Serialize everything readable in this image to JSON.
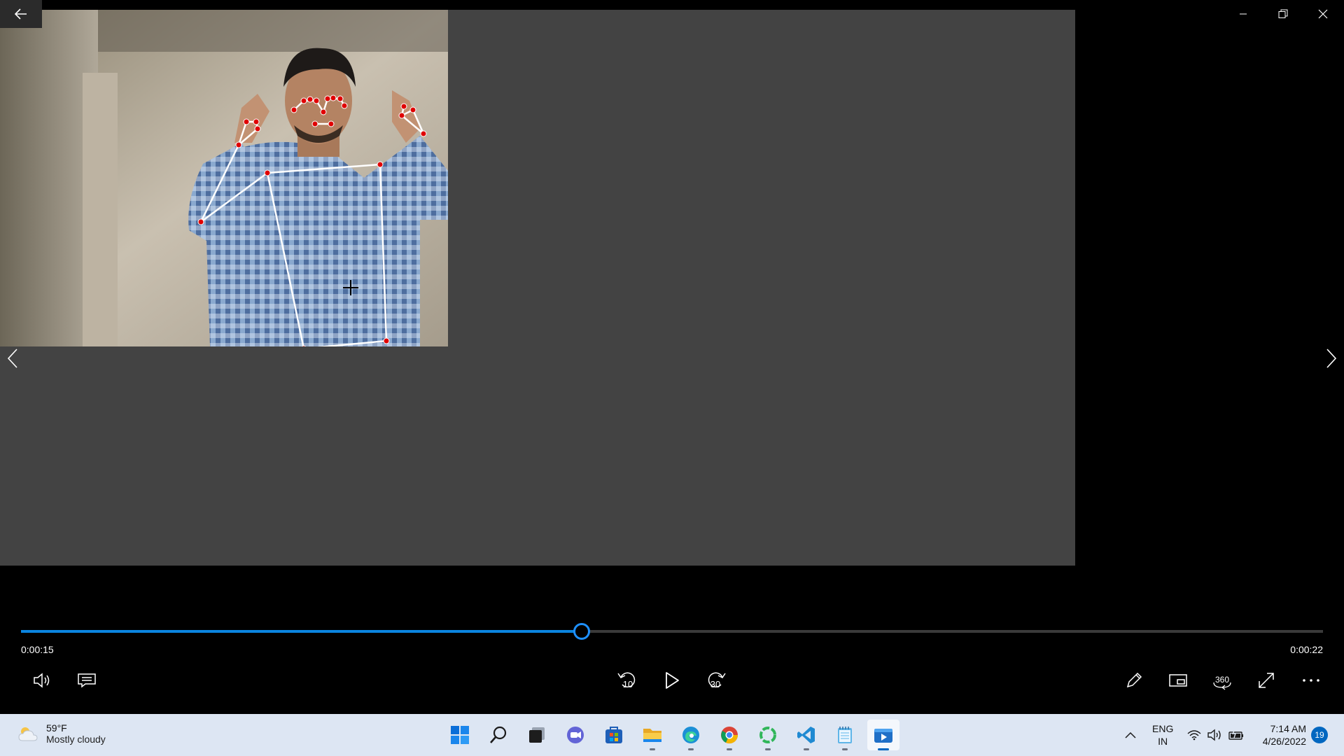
{
  "player": {
    "current_time": "0:00:15",
    "total_time": "0:00:22",
    "progress": 0.4305
  },
  "taskbar": {
    "weather_temp": "59°F",
    "weather_desc": "Mostly cloudy",
    "lang_line1": "ENG",
    "lang_line2": "IN",
    "time": "7:14 AM",
    "date": "4/26/2022",
    "notification_count": "19"
  },
  "colors": {
    "accent": "#0a84e0",
    "video_bg": "#434343",
    "taskbar_bg": "#dde6f3",
    "landmark": "#e00000"
  },
  "icons": {
    "replay_label": "10",
    "forward_label": "30",
    "view360_label": "360"
  }
}
